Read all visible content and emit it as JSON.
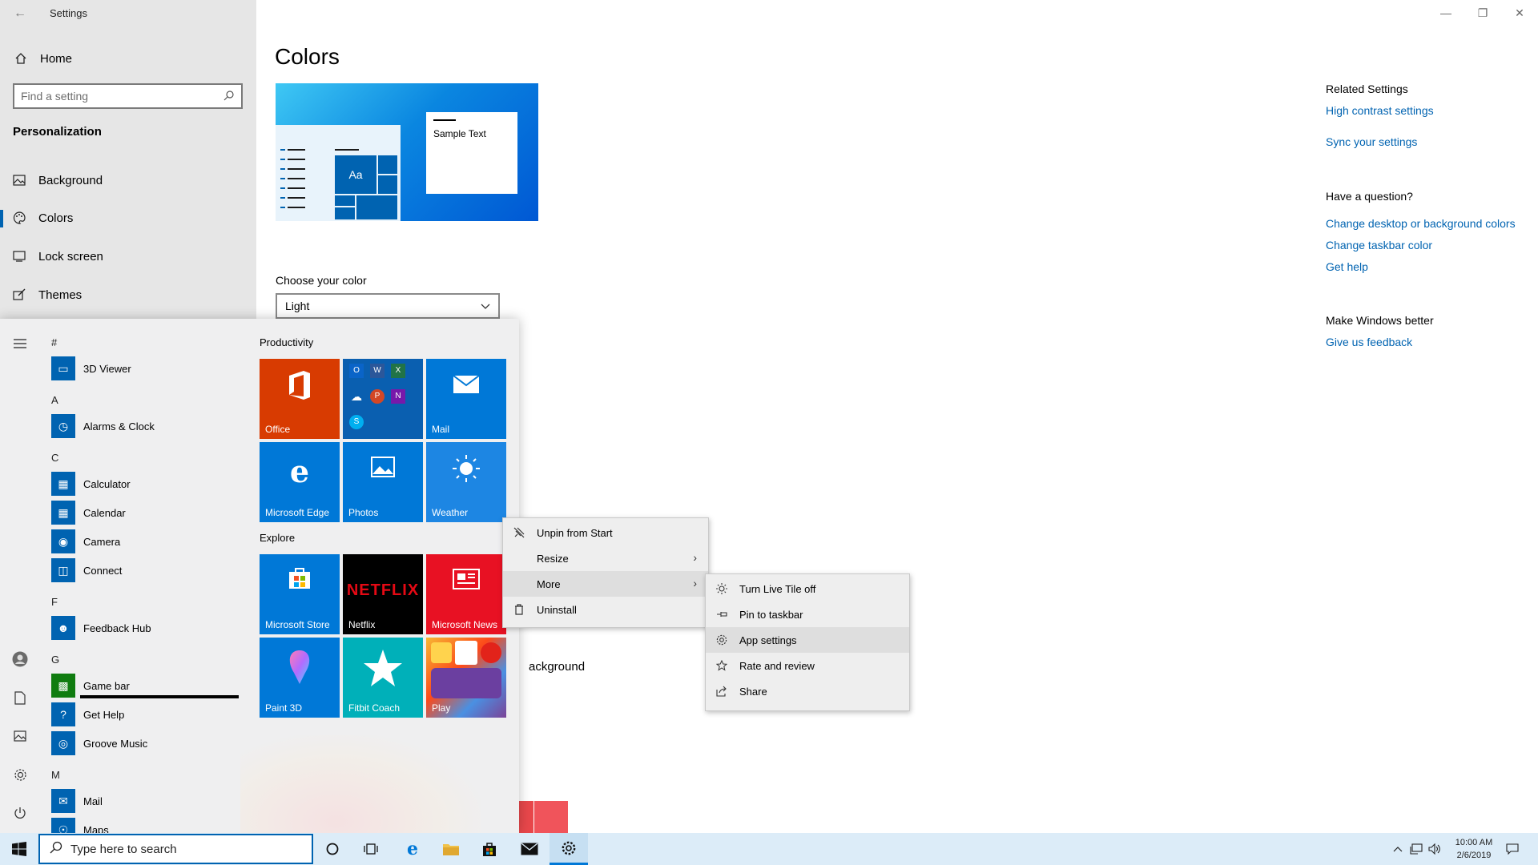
{
  "window": {
    "title": "Settings",
    "minimize": "—",
    "maximize": "❐",
    "close": "✕"
  },
  "sidebar": {
    "home": "Home",
    "search_placeholder": "Find a setting",
    "section": "Personalization",
    "items": [
      {
        "label": "Background",
        "icon": "picture-icon"
      },
      {
        "label": "Colors",
        "icon": "palette-icon",
        "selected": true
      },
      {
        "label": "Lock screen",
        "icon": "lock-screen-icon"
      },
      {
        "label": "Themes",
        "icon": "themes-icon"
      }
    ]
  },
  "main": {
    "title": "Colors",
    "preview_sample_text": "Sample Text",
    "preview_tile_text": "Aa",
    "choose_color_label": "Choose your color",
    "choose_color_value": "Light",
    "background_partial_label": "ackground",
    "accent_color": "#0063b1"
  },
  "related": {
    "heading": "Related Settings",
    "links": [
      "High contrast settings",
      "Sync your settings"
    ],
    "question_heading": "Have a question?",
    "question_links": [
      "Change desktop or background colors",
      "Change taskbar color",
      "Get help"
    ],
    "better_heading": "Make Windows better",
    "better_link": "Give us feedback"
  },
  "start_menu": {
    "app_list": [
      {
        "letter": "#"
      },
      {
        "app": "3D Viewer"
      },
      {
        "letter": "A"
      },
      {
        "app": "Alarms & Clock"
      },
      {
        "letter": "C"
      },
      {
        "app": "Calculator"
      },
      {
        "app": "Calendar"
      },
      {
        "app": "Camera"
      },
      {
        "app": "Connect"
      },
      {
        "letter": "F"
      },
      {
        "app": "Feedback Hub"
      },
      {
        "letter": "G"
      },
      {
        "app": "Game bar"
      },
      {
        "app": "Get Help"
      },
      {
        "app": "Groove Music"
      },
      {
        "letter": "M"
      },
      {
        "app": "Mail"
      },
      {
        "app": "Maps"
      }
    ],
    "productivity_label": "Productivity",
    "explore_label": "Explore",
    "tiles": {
      "office": "Office",
      "mail": "Mail",
      "edge": "Microsoft Edge",
      "photos": "Photos",
      "weather": "Weather",
      "store": "Microsoft Store",
      "netflix": "Netflix",
      "netflix_logo": "NETFLIX",
      "news": "Microsoft News",
      "paint3d": "Paint 3D",
      "fitbit": "Fitbit Coach",
      "play": "Play"
    }
  },
  "context_menu": {
    "items": [
      {
        "label": "Unpin from Start",
        "icon": "unpin-icon"
      },
      {
        "label": "Resize",
        "submenu": true
      },
      {
        "label": "More",
        "submenu": true,
        "highlighted": true
      },
      {
        "label": "Uninstall",
        "icon": "trash-icon"
      }
    ]
  },
  "more_menu": {
    "items": [
      {
        "label": "Turn Live Tile off",
        "icon": "live-tile-icon"
      },
      {
        "label": "Pin to taskbar",
        "icon": "pin-icon"
      },
      {
        "label": "App settings",
        "icon": "gear-icon",
        "highlighted": true
      },
      {
        "label": "Rate and review",
        "icon": "star-icon"
      },
      {
        "label": "Share",
        "icon": "share-icon"
      }
    ]
  },
  "taskbar": {
    "search_placeholder": "Type here to search",
    "time": "10:00 AM",
    "date": "2/6/2019"
  }
}
